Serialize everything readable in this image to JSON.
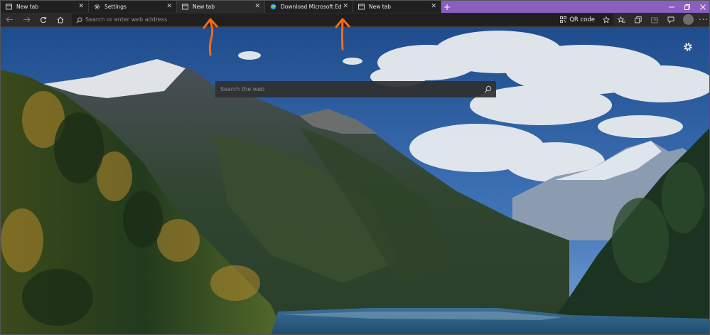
{
  "tabs": [
    {
      "title": "New tab",
      "icon": "new-tab-page-icon"
    },
    {
      "title": "Settings",
      "icon": "gear-icon"
    },
    {
      "title": "New tab",
      "icon": "new-tab-page-icon"
    },
    {
      "title": "Download Microsoft Edge Insider",
      "icon": "edge-logo-icon"
    },
    {
      "title": "New tab",
      "icon": "new-tab-page-icon"
    }
  ],
  "tab_close_glyph": "✕",
  "new_tab_glyph": "+",
  "address_bar": {
    "placeholder": "Search or enter web address"
  },
  "toolbar": {
    "qr_label": "QR code"
  },
  "page": {
    "search_placeholder": "Search the web"
  },
  "colors": {
    "tab_strip_accent": "#8a5fbf",
    "annotation_arrow": "#f26b1d"
  }
}
